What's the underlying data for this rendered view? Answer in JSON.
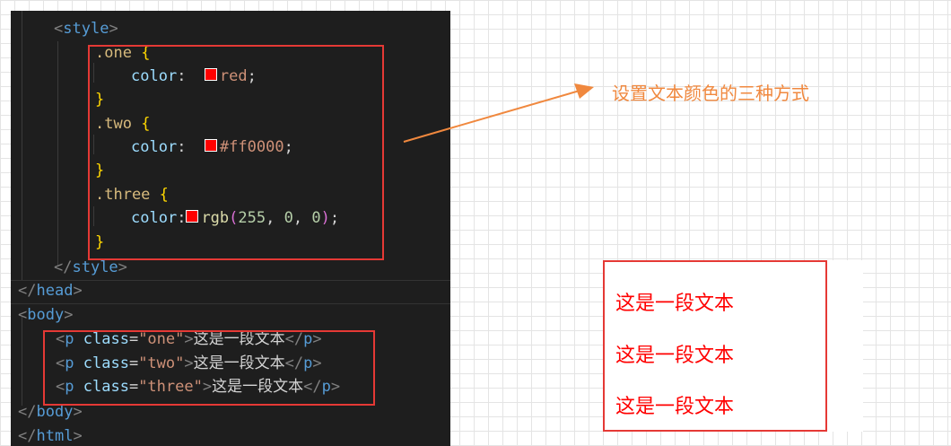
{
  "editor": {
    "style_open": [
      "<",
      "style",
      ">"
    ],
    "rules": [
      {
        "selector": ".one",
        "prop": "color",
        "value": "red"
      },
      {
        "selector": ".two",
        "prop": "color",
        "value": "#ff0000"
      },
      {
        "selector": ".three",
        "prop": "color",
        "fn": "rgb",
        "args": [
          "255",
          "0",
          "0"
        ]
      }
    ],
    "brace_open": "{",
    "brace_close": "}",
    "colon": ":",
    "semicolon": ";",
    "comma": ",",
    "paren_open": "(",
    "paren_close": ")",
    "style_close": [
      "</",
      "style",
      ">"
    ],
    "head_close": [
      "</",
      "head",
      ">"
    ],
    "body_open": [
      "<",
      "body",
      ">"
    ],
    "paragraphs": [
      {
        "tag": "p",
        "attr": "class",
        "class_value": "\"one\"",
        "text": "这是一段文本"
      },
      {
        "tag": "p",
        "attr": "class",
        "class_value": "\"two\"",
        "text": "这是一段文本"
      },
      {
        "tag": "p",
        "attr": "class",
        "class_value": "\"three\"",
        "text": "这是一段文本"
      }
    ],
    "body_close": [
      "</",
      "body",
      ">"
    ],
    "html_close": [
      "</",
      "html",
      ">"
    ],
    "swatch_color": "#ff0000"
  },
  "annotation": {
    "caption": "设置文本颜色的三种方式",
    "arrow_color": "#f0883e",
    "box_color": "#e53935"
  },
  "preview": {
    "lines": [
      "这是一段文本",
      "这是一段文本",
      "这是一段文本"
    ],
    "text_color": "#ff0000"
  }
}
